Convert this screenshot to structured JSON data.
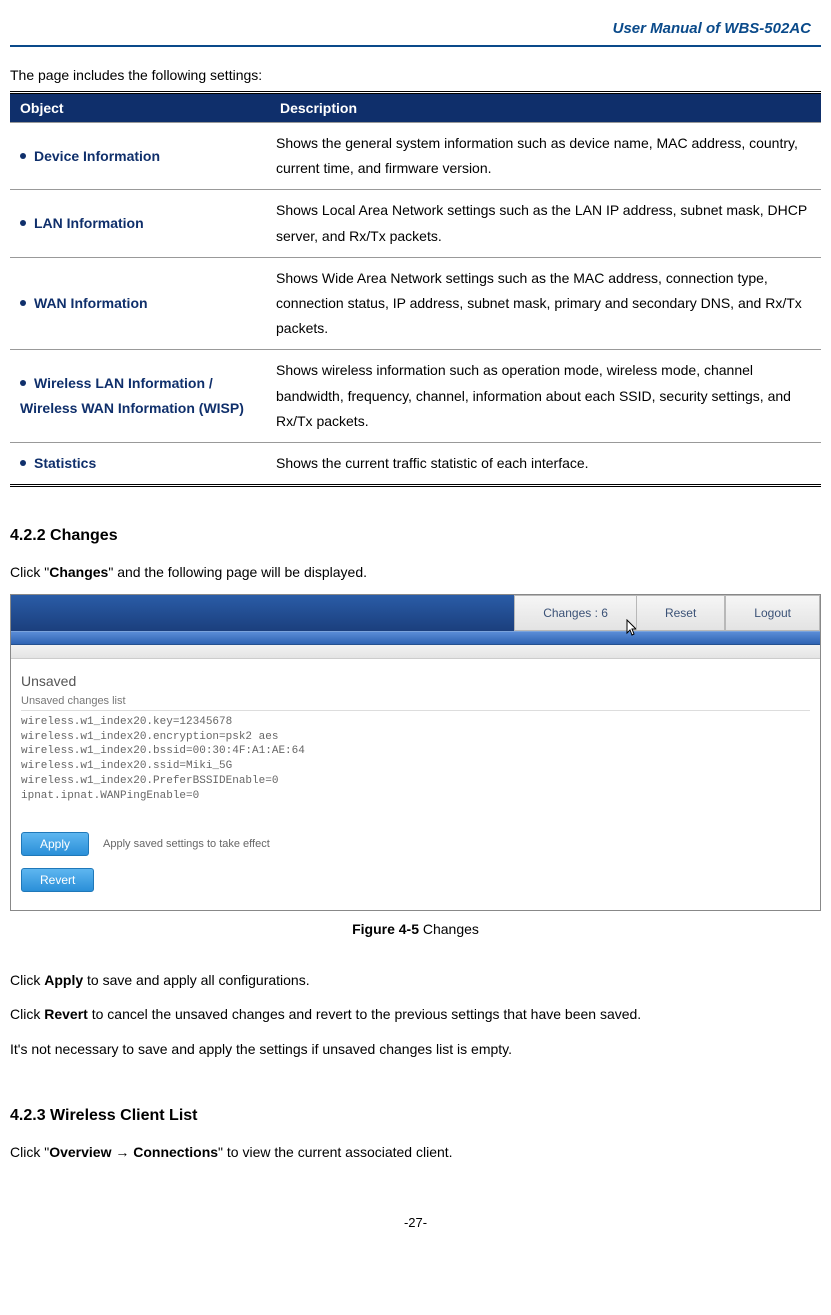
{
  "header": {
    "title": "User Manual of WBS-502AC"
  },
  "intro": "The page includes the following settings:",
  "table": {
    "head": {
      "object": "Object",
      "description": "Description"
    },
    "rows": [
      {
        "object": "Device Information",
        "description": "Shows the general system information such as device name, MAC address, country, current time, and firmware version."
      },
      {
        "object": "LAN Information",
        "description": "Shows Local Area Network settings such as the LAN IP address, subnet mask, DHCP server, and Rx/Tx packets."
      },
      {
        "object": "WAN Information",
        "description": "Shows Wide Area Network settings such as the MAC address, connection type, connection status, IP address, subnet mask, primary and secondary DNS, and Rx/Tx packets."
      },
      {
        "object": "Wireless LAN Information / Wireless WAN Information (WISP)",
        "description": "Shows wireless information such as operation mode, wireless mode, channel bandwidth, frequency, channel, information about each SSID, security settings, and Rx/Tx packets."
      },
      {
        "object": "Statistics",
        "description": "Shows the current traffic statistic of each interface."
      }
    ]
  },
  "section422": {
    "heading": "4.2.2   Changes",
    "line_pre": "Click \"",
    "line_bold": "Changes",
    "line_post": "\" and the following page will be displayed."
  },
  "screenshot": {
    "tabs": {
      "changes": "Changes : 6",
      "reset": "Reset",
      "logout": "Logout"
    },
    "unsaved_title": "Unsaved",
    "unsaved_sub": "Unsaved changes list",
    "lines": "wireless.w1_index20.key=12345678\nwireless.w1_index20.encryption=psk2 aes\nwireless.w1_index20.bssid=00:30:4F:A1:AE:64\nwireless.w1_index20.ssid=Miki_5G\nwireless.w1_index20.PreferBSSIDEnable=0\nipnat.ipnat.WANPingEnable=0",
    "apply_btn": "Apply",
    "apply_desc": "Apply saved settings to take effect",
    "revert_btn": "Revert"
  },
  "figure_caption": {
    "bold": "Figure 4-5",
    "rest": " Changes"
  },
  "para_apply": {
    "pre": "Click ",
    "bold": "Apply",
    "post": " to save and apply all configurations."
  },
  "para_revert": {
    "pre": "Click ",
    "bold": "Revert",
    "post": " to cancel the unsaved changes and revert to the previous settings that have been saved."
  },
  "para_note": "It's not necessary to save and apply the settings if unsaved changes list is empty.",
  "section423": {
    "heading": "4.2.3   Wireless Client List",
    "line_pre": "Click \"",
    "line_bold1": "Overview",
    "arrow": " → ",
    "line_bold2": "Connections",
    "line_post": "\" to view the current associated client."
  },
  "pagenum": "-27-"
}
